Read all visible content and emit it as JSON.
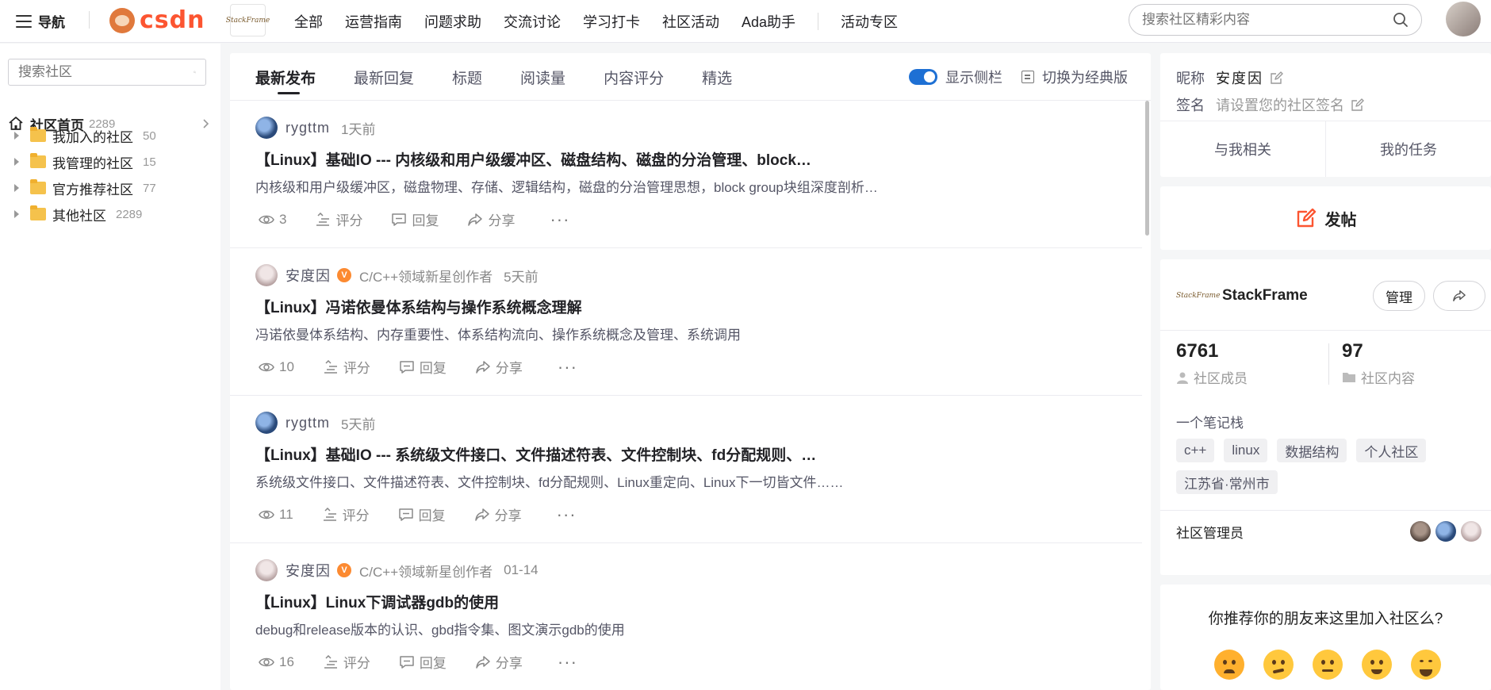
{
  "topbar": {
    "nav_label": "导航",
    "logo_text": "csdn",
    "community_logo_text": "StackFrame",
    "menu": [
      "全部",
      "运营指南",
      "问题求助",
      "交流讨论",
      "学习打卡",
      "社区活动",
      "Ada助手"
    ],
    "special_menu": "活动专区",
    "search_placeholder": "搜索社区精彩内容"
  },
  "leftnav": {
    "search_placeholder": "搜索社区",
    "home": {
      "label": "社区首页",
      "count": "2289"
    },
    "items": [
      {
        "label": "我加入的社区",
        "count": "50"
      },
      {
        "label": "我管理的社区",
        "count": "15"
      },
      {
        "label": "官方推荐社区",
        "count": "77"
      },
      {
        "label": "其他社区",
        "count": "2289"
      }
    ]
  },
  "feed": {
    "tabs": [
      "最新发布",
      "最新回复",
      "标题",
      "阅读量",
      "内容评分",
      "精选"
    ],
    "toggle_label": "显示侧栏",
    "classic_label": "切换为经典版",
    "action_labels": {
      "rate": "评分",
      "reply": "回复",
      "share": "分享"
    },
    "posts": [
      {
        "author": "rygttm",
        "creator": "",
        "time": "1天前",
        "title": "【Linux】基础IO --- 内核级和用户级缓冲区、磁盘结构、磁盘的分治管理、block…",
        "desc": "内核级和用户级缓冲区，磁盘物理、存储、逻辑结构，磁盘的分治管理思想，block group块组深度剖析…",
        "views": "3"
      },
      {
        "author": "安度因",
        "creator": "C/C++领域新星创作者",
        "time": "5天前",
        "title": "【Linux】冯诺依曼体系结构与操作系统概念理解",
        "desc": "冯诺依曼体系结构、内存重要性、体系结构流向、操作系统概念及管理、系统调用",
        "views": "10"
      },
      {
        "author": "rygttm",
        "creator": "",
        "time": "5天前",
        "title": "【Linux】基础IO --- 系统级文件接口、文件描述符表、文件控制块、fd分配规则、…",
        "desc": "系统级文件接口、文件描述符表、文件控制块、fd分配规则、Linux重定向、Linux下一切皆文件……",
        "views": "11"
      },
      {
        "author": "安度因",
        "creator": "C/C++领域新星创作者",
        "time": "01-14",
        "title": "【Linux】Linux下调试器gdb的使用",
        "desc": "debug和release版本的认识、gbd指令集、图文演示gdb的使用",
        "views": "16"
      }
    ]
  },
  "profile": {
    "nick_key": "昵称",
    "nick_value": "安度因",
    "sign_key": "签名",
    "sign_value": "请设置您的社区签名",
    "tab_related": "与我相关",
    "tab_tasks": "我的任务"
  },
  "post_button": "发帖",
  "community": {
    "logo_text": "StackFrame",
    "name": "StackFrame",
    "manage_label": "管理",
    "members": "6761",
    "members_label": "社区成员",
    "contents": "97",
    "contents_label": "社区内容",
    "desc": "一个笔记栈",
    "tags": [
      "c++",
      "linux",
      "数据结构",
      "个人社区",
      "江苏省·常州市"
    ],
    "admins_label": "社区管理员"
  },
  "recommend": {
    "question": "你推荐你的朋友来这里加入社区么?"
  }
}
